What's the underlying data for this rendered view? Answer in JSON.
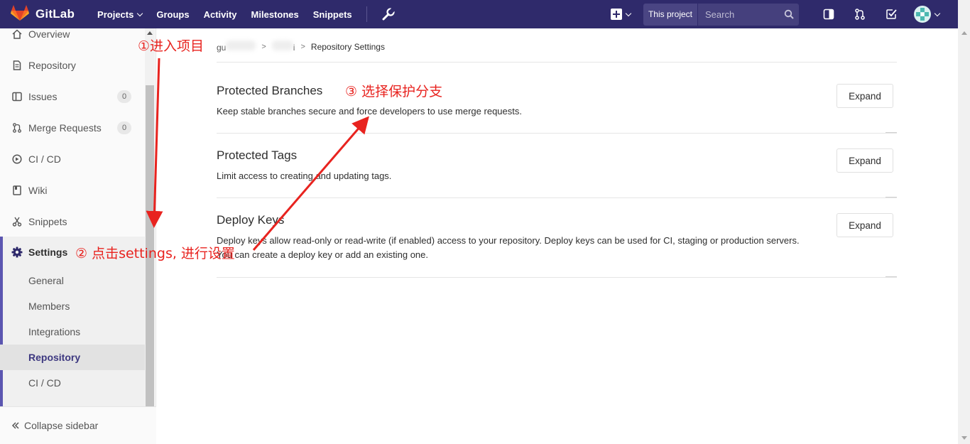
{
  "navbar": {
    "brand": "GitLab",
    "links": [
      "Projects",
      "Groups",
      "Activity",
      "Milestones",
      "Snippets"
    ],
    "search_scope": "This project",
    "search_placeholder": "Search",
    "colors": {
      "background": "#2f2a6b",
      "accent": "#fc6d26"
    }
  },
  "sidebar": {
    "items": [
      {
        "label": "Overview",
        "icon": "home-icon"
      },
      {
        "label": "Repository",
        "icon": "document-icon"
      },
      {
        "label": "Issues",
        "icon": "issues-icon",
        "count": "0"
      },
      {
        "label": "Merge Requests",
        "icon": "merge-request-icon",
        "count": "0"
      },
      {
        "label": "CI / CD",
        "icon": "rocket-icon"
      },
      {
        "label": "Wiki",
        "icon": "book-icon"
      },
      {
        "label": "Snippets",
        "icon": "scissors-icon"
      }
    ],
    "settings": {
      "label": "Settings",
      "icon": "gear-icon",
      "sub_items": [
        "General",
        "Members",
        "Integrations",
        "Repository",
        "CI / CD"
      ],
      "active": "Repository"
    },
    "collapse_label": "Collapse sidebar"
  },
  "breadcrumb": {
    "first": "gu",
    "second": "i",
    "current": "Repository Settings"
  },
  "sections": [
    {
      "title": "Protected Branches",
      "description": "Keep stable branches secure and force developers to use merge requests.",
      "button": "Expand"
    },
    {
      "title": "Protected Tags",
      "description": "Limit access to creating and updating tags.",
      "button": "Expand"
    },
    {
      "title": "Deploy Keys",
      "description": "Deploy keys allow read-only or read-write (if enabled) access to your repository. Deploy keys can be used for CI, staging or production servers. You can create a deploy key or add an existing one.",
      "button": "Expand"
    }
  ],
  "annotations": {
    "step1": "①进入项目",
    "step2": "② 点击settings, 进行设置",
    "step3": "③ 选择保护分支",
    "color": "#e8231f"
  }
}
